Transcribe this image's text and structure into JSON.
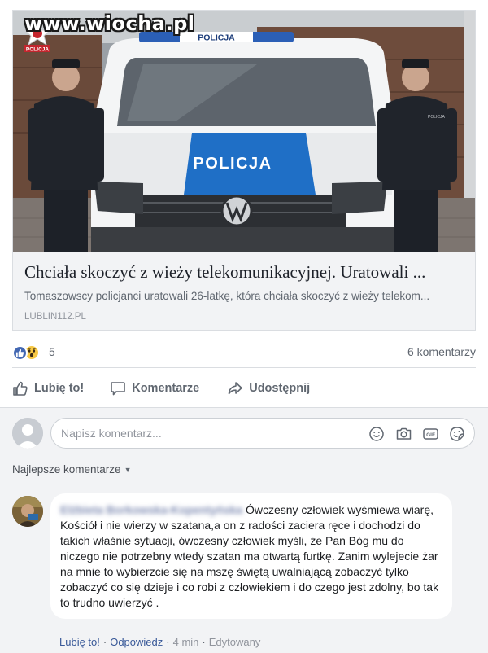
{
  "watermark": "www.wiocha.pl",
  "post": {
    "link_preview": {
      "image_texts": {
        "van_light_label": "POLICJA",
        "van_side_label": "POLICJA",
        "badge_label": "POLICJA",
        "officer_badge": "POLICJA"
      },
      "title": "Chciała skoczyć z wieży telekomunikacyjnej. Uratowali ...",
      "description": "Tomaszowscy policjanci uratowali 26-latkę, która chciała skoczyć z wieży telekom...",
      "domain": "LUBLIN112.PL"
    },
    "reactions": {
      "icons": [
        "like-icon",
        "wow-emoji-icon"
      ],
      "count": "5"
    },
    "comments_count_label": "6 komentarzy",
    "actions": {
      "like_label": "Lubię to!",
      "comment_label": "Komentarze",
      "share_label": "Udostępnij"
    }
  },
  "comment_composer": {
    "placeholder": "Napisz komentarz...",
    "icons": [
      "emoji-icon",
      "camera-icon",
      "gif-icon",
      "sticker-icon"
    ]
  },
  "comments": {
    "sort_label": "Najlepsze komentarze",
    "items": [
      {
        "author": "Elżbieta Borkowska-Kopentyńska",
        "text": "Ówczesny człowiek wyśmiewa wiarę, Kościół i nie wierzy w szatana,a on z radości zaciera ręce i dochodzi do takich właśnie sytuacji, ówczesny człowiek myśli, że Pan Bóg mu do niczego nie potrzebny wtedy szatan ma otwartą furtkę. Zanim wylejecie żar na mnie to wybierzcie się na mszę świętą uwalniającą zobaczyć tylko zobaczyć co się dzieje i co robi z człowiekiem i do czego jest zdolny, bo tak to trudno uwierzyć .",
        "like_label": "Lubię to!",
        "reply_label": "Odpowiedz",
        "time": "4 min",
        "edited_label": "Edytowany"
      }
    ]
  },
  "colors": {
    "facebook_blue": "#4267b2",
    "link_blue": "#385898",
    "secondary_text": "#606770",
    "police_blue": "#1f6fc6"
  }
}
